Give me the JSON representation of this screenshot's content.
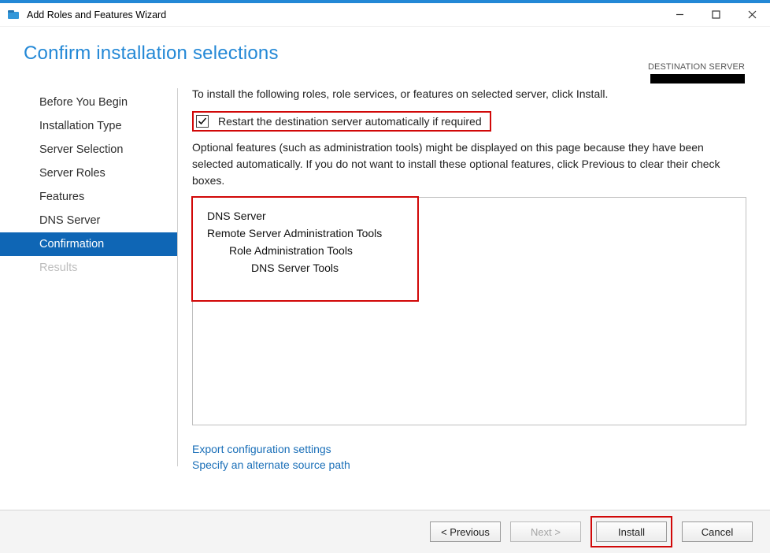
{
  "titlebar": {
    "title": "Add Roles and Features Wizard"
  },
  "header": {
    "page_title": "Confirm installation selections",
    "destination_label": "DESTINATION SERVER"
  },
  "sidebar": {
    "items": [
      {
        "label": "Before You Begin",
        "state": "normal"
      },
      {
        "label": "Installation Type",
        "state": "normal"
      },
      {
        "label": "Server Selection",
        "state": "normal"
      },
      {
        "label": "Server Roles",
        "state": "normal"
      },
      {
        "label": "Features",
        "state": "normal"
      },
      {
        "label": "DNS Server",
        "state": "normal"
      },
      {
        "label": "Confirmation",
        "state": "active"
      },
      {
        "label": "Results",
        "state": "disabled"
      }
    ]
  },
  "content": {
    "instruction": "To install the following roles, role services, or features on selected server, click Install.",
    "checkbox_label": "Restart the destination server automatically if required",
    "checkbox_checked": true,
    "note": "Optional features (such as administration tools) might be displayed on this page because they have been selected automatically. If you do not want to install these optional features, click Previous to clear their check boxes.",
    "selected_features": [
      {
        "label": "DNS Server",
        "level": 1
      },
      {
        "label": "Remote Server Administration Tools",
        "level": 1
      },
      {
        "label": "Role Administration Tools",
        "level": 2
      },
      {
        "label": "DNS Server Tools",
        "level": 3
      }
    ],
    "links": {
      "export": "Export configuration settings",
      "alt_source": "Specify an alternate source path"
    }
  },
  "footer": {
    "previous": "< Previous",
    "next": "Next >",
    "install": "Install",
    "cancel": "Cancel"
  }
}
